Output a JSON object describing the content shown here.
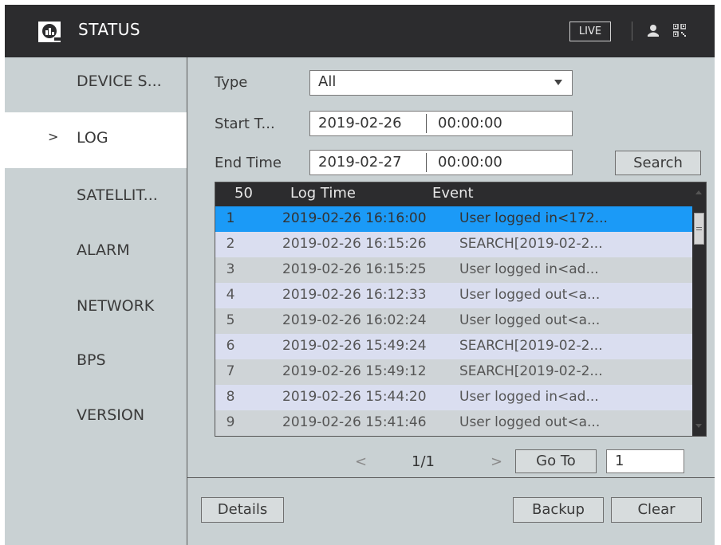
{
  "titlebar": {
    "title": "STATUS",
    "live_label": "LIVE",
    "logo_icon": "magnifier-chart-icon",
    "user_icon": "user-icon",
    "qr_icon": "qr-code-icon"
  },
  "sidebar": {
    "items": [
      {
        "label": "DEVICE S..."
      },
      {
        "label": "LOG",
        "active": true
      },
      {
        "label": "SATELLIT..."
      },
      {
        "label": "ALARM"
      },
      {
        "label": "NETWORK"
      },
      {
        "label": "BPS"
      },
      {
        "label": "VERSION"
      }
    ],
    "active_marker": ">"
  },
  "form": {
    "type_label": "Type",
    "type_value": "All",
    "start_label": "Start T...",
    "start_date": "2019-02-26",
    "start_time": "00:00:00",
    "end_label": "End Time",
    "end_date": "2019-02-27",
    "end_time": "00:00:00",
    "search_label": "Search"
  },
  "table": {
    "headers": {
      "count": "50",
      "time": "Log Time",
      "event": "Event"
    },
    "rows": [
      {
        "num": "1",
        "time": "2019-02-26 16:16:00",
        "event": "User logged in<172..."
      },
      {
        "num": "2",
        "time": "2019-02-26 16:15:26",
        "event": "SEARCH[2019-02-2..."
      },
      {
        "num": "3",
        "time": "2019-02-26 16:15:25",
        "event": "User logged in<ad..."
      },
      {
        "num": "4",
        "time": "2019-02-26 16:12:33",
        "event": "User logged out<a..."
      },
      {
        "num": "5",
        "time": "2019-02-26 16:02:24",
        "event": "User logged out<a..."
      },
      {
        "num": "6",
        "time": "2019-02-26 15:49:24",
        "event": "SEARCH[2019-02-2..."
      },
      {
        "num": "7",
        "time": "2019-02-26 15:49:12",
        "event": "SEARCH[2019-02-2..."
      },
      {
        "num": "8",
        "time": "2019-02-26 15:44:20",
        "event": "User logged in<ad..."
      },
      {
        "num": "9",
        "time": "2019-02-26 15:41:46",
        "event": "User logged out<a..."
      }
    ],
    "selected_index": 0
  },
  "pagination": {
    "prev": "<",
    "page_info": "1/1",
    "next": ">",
    "goto_label": "Go To",
    "goto_value": "1"
  },
  "footer": {
    "details_label": "Details",
    "backup_label": "Backup",
    "clear_label": "Clear"
  },
  "colors": {
    "titlebar_bg": "#2c2c2e",
    "panel_bg": "#c9d1d3",
    "selected_row": "#1b9af7"
  }
}
